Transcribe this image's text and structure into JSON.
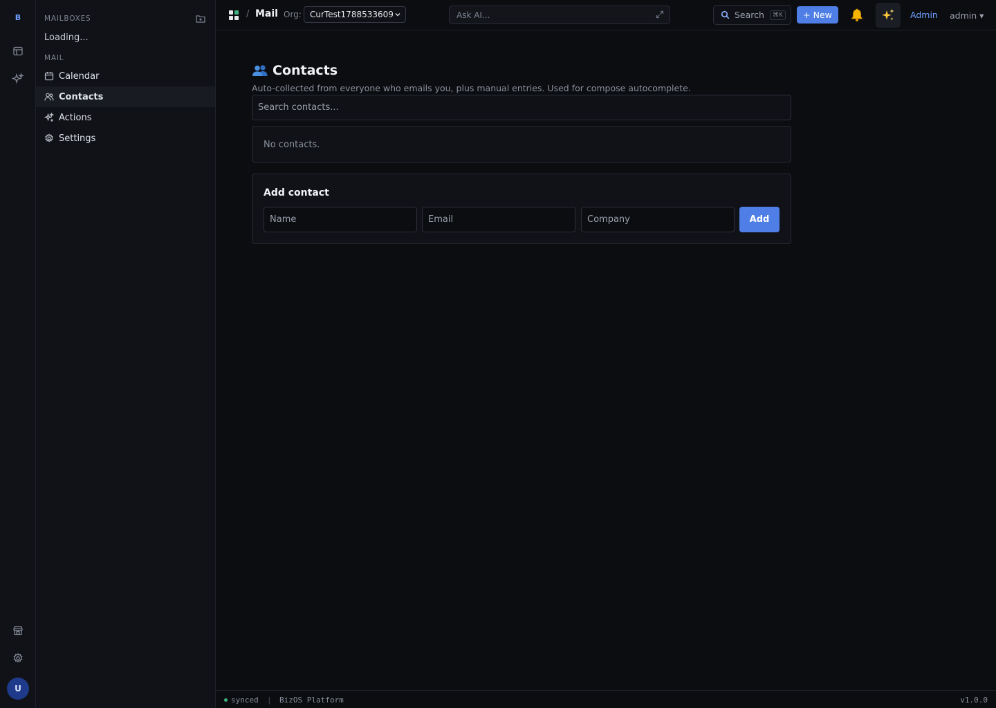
{
  "rail": {
    "logo": "B",
    "avatar_initial": "U",
    "icons": [
      "table-icon",
      "sparkles-icon",
      "store-icon",
      "gear-icon"
    ]
  },
  "sidebar": {
    "mailboxes_title": "MAILBOXES",
    "loading_text": "Loading...",
    "mail_title": "MAIL",
    "items": [
      {
        "label": "Calendar",
        "icon": "calendar-icon"
      },
      {
        "label": "Contacts",
        "icon": "users-icon",
        "active": true
      },
      {
        "label": "Actions",
        "icon": "sparkles-icon"
      },
      {
        "label": "Settings",
        "icon": "gear-icon"
      }
    ]
  },
  "topbar": {
    "separator": "/",
    "app_name": "Mail",
    "org_label": "Org:",
    "org_value": "CurTest1788533609",
    "ask_ai_placeholder": "Ask AI...",
    "search_label": "Search",
    "search_shortcut": "⌘K",
    "new_label": "+ New",
    "admin_label": "Admin",
    "user_menu_label": "admin ▾"
  },
  "main": {
    "title": "Contacts",
    "subtitle": "Auto-collected from everyone who emails you, plus manual entries. Used for compose autocomplete.",
    "search_placeholder": "Search contacts...",
    "empty_text": "No contacts.",
    "add_contact": {
      "title": "Add contact",
      "name_placeholder": "Name",
      "email_placeholder": "Email",
      "company_placeholder": "Company",
      "add_label": "Add"
    }
  },
  "statusbar": {
    "sync_status": "synced",
    "separator": "|",
    "platform": "BizOS Platform",
    "version": "v1.0.0"
  },
  "colors": {
    "background": "#0c0d11",
    "sidebar": "#101217",
    "accent": "#4f7fe6",
    "link": "#6ea0ff",
    "synced_dot": "#3fb27f"
  }
}
